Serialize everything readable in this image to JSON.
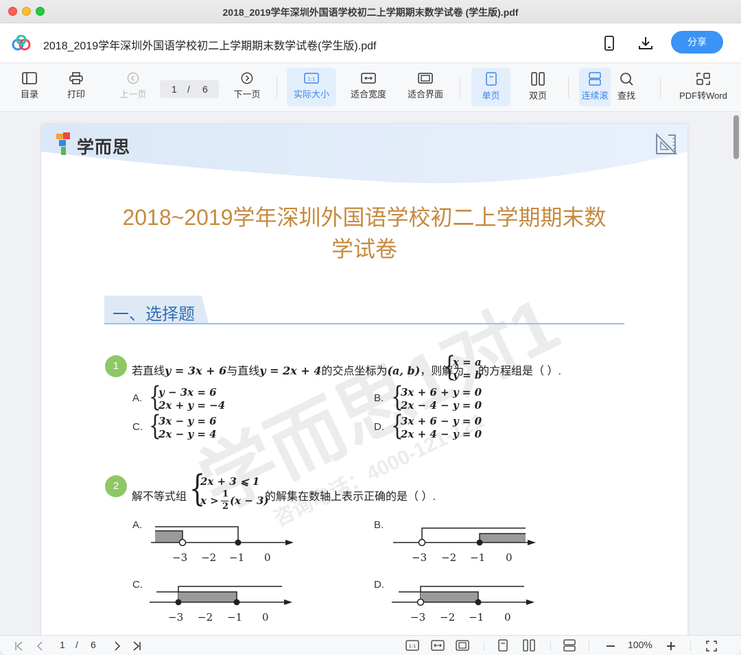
{
  "window": {
    "title": "2018_2019学年深圳外国语学校初二上学期期末数学试卷 (学生版).pdf"
  },
  "header": {
    "doc_title": "2018_2019学年深圳外国语学校初二上学期期末数学试卷(学生版).pdf",
    "share_label": "分享"
  },
  "toolbar": {
    "toc": "目录",
    "print": "打印",
    "prev": "上一页",
    "page_current": "1",
    "page_sep": "/",
    "page_total": "6",
    "next": "下一页",
    "actual_size": "实际大小",
    "fit_width": "适合宽度",
    "fit_page": "适合界面",
    "single": "单页",
    "double": "双页",
    "continuous": "连续滚",
    "search": "查找",
    "pdf_to_word": "PDF转Word"
  },
  "page": {
    "brand": "学而思",
    "title_line1": "2018~2019学年深圳外国语学校初二上学期期末数",
    "title_line2": "学试卷",
    "section": "一、选择题",
    "watermark_main": "学而思1对1",
    "watermark_phone": "咨询电话：4000-121-121",
    "q1": {
      "num": "1",
      "t1": "若直线",
      "m1": "y = 3x + 6",
      "t2": "与直线",
      "m2": "y = 2x + 4",
      "t3": "的交点坐标为",
      "m3": "(a, b)",
      "t4": "，则解为",
      "sys_l1": "x = a",
      "sys_l2": "y = b",
      "t5": "的方程组是（    ）.",
      "optA_label": "A.",
      "optA_l1": "y − 3x = 6",
      "optA_l2": "2x + y = −4",
      "optB_label": "B.",
      "optB_l1": "3x + 6 + y = 0",
      "optB_l2": "2x − 4 − y = 0",
      "optC_label": "C.",
      "optC_l1": "3x − y = 6",
      "optC_l2": "2x − y = 4",
      "optD_label": "D.",
      "optD_l1": "3x + 6 − y = 0",
      "optD_l2": "2x + 4 − y = 0"
    },
    "q2": {
      "num": "2",
      "t1": "解不等式组",
      "sys_l1": "2x + 3 ⩽ 1",
      "sys_l2a": "x >",
      "frac_num": "1",
      "frac_den": "2",
      "sys_l2b": "(x − 3)",
      "t2": "的解集在数轴上表示正确的是（    ）.",
      "optA_label": "A.",
      "optB_label": "B.",
      "optC_label": "C.",
      "optD_label": "D.",
      "ticks": [
        "−3",
        "−2",
        "−1",
        "0"
      ]
    }
  },
  "status": {
    "page_current": "1",
    "page_sep": "/",
    "page_total": "6",
    "zoom": "100%"
  }
}
